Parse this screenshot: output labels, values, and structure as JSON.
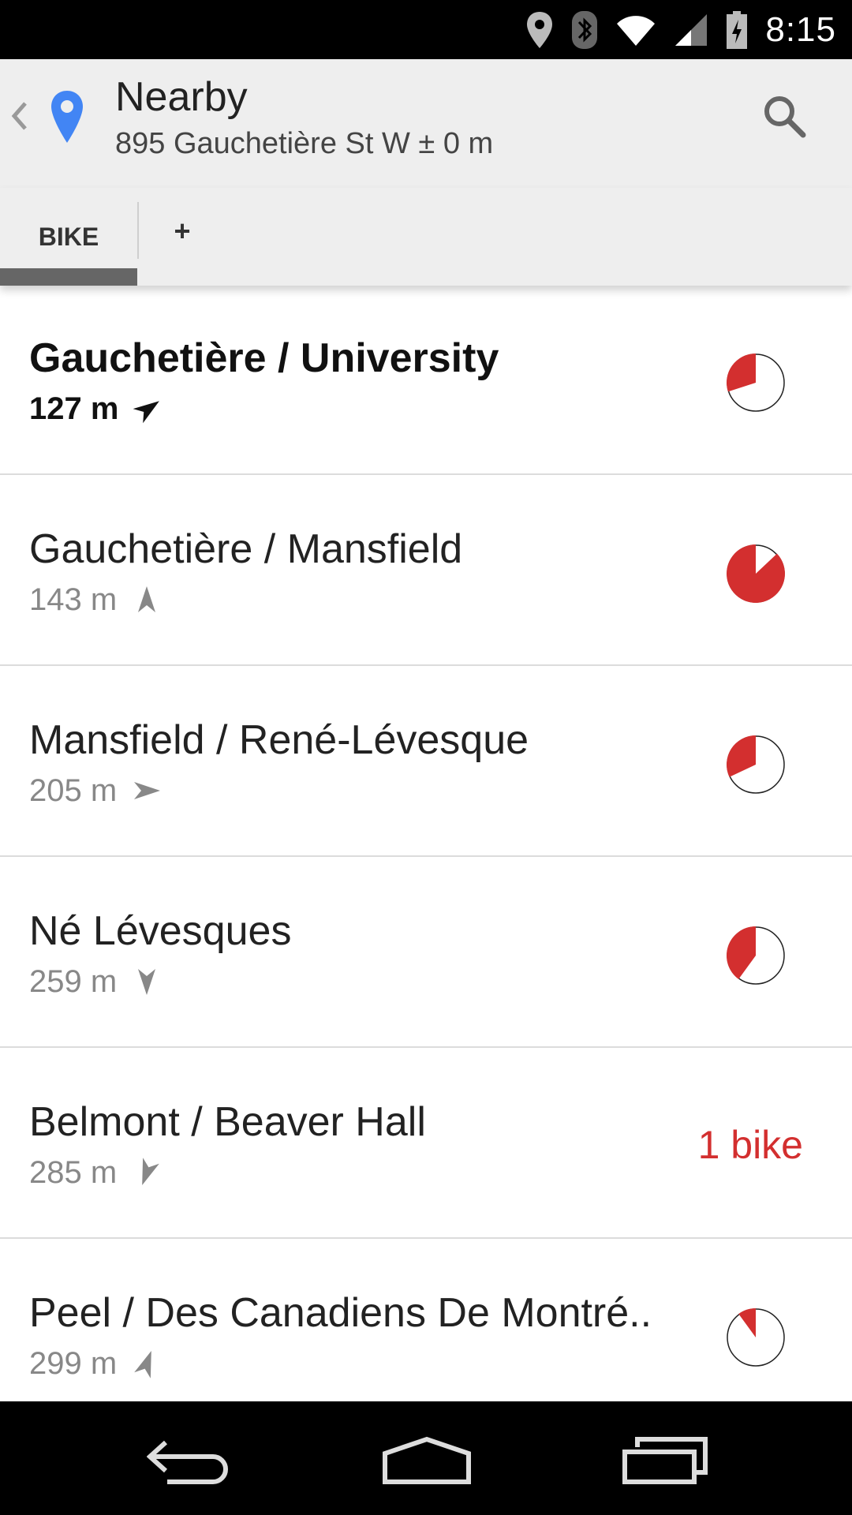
{
  "status_bar": {
    "time": "8:15",
    "icons": [
      "location-icon",
      "bluetooth-icon",
      "wifi-icon",
      "signal-icon",
      "battery-charging-icon"
    ]
  },
  "app_bar": {
    "title": "Nearby",
    "subtitle": "895 Gauchetière St W ± 0 m",
    "icons": [
      "chevron-left-icon",
      "map-pin-icon",
      "search-icon"
    ],
    "pin_color": "#4285f4"
  },
  "tabs": {
    "bike_label": "BIKE",
    "add_label": "+"
  },
  "stations": [
    {
      "name": "Gauchetière / University",
      "distance": "127 m",
      "bearing_deg": 55,
      "availability_fraction": 0.3,
      "bold": true
    },
    {
      "name": "Gauchetière / Mansfield",
      "distance": "143 m",
      "bearing_deg": 0,
      "availability_fraction": 0.87
    },
    {
      "name": "Mansfield / René-Lévesque",
      "distance": "205 m",
      "bearing_deg": 90,
      "availability_fraction": 0.32
    },
    {
      "name": "Né Lévesques",
      "distance": "259 m",
      "bearing_deg": 180,
      "availability_fraction": 0.4
    },
    {
      "name": "Belmont / Beaver Hall",
      "distance": "285 m",
      "bearing_deg": 200,
      "availability_text": "1 bike"
    },
    {
      "name": "Peel / Des Canadiens De Montré..",
      "distance": "299 m",
      "bearing_deg": 20,
      "availability_fraction": 0.1
    }
  ],
  "colors": {
    "availability_red": "#d32f2f",
    "app_bar_bg": "#eeeeee"
  },
  "nav_bar": {
    "icons": [
      "back-icon",
      "home-icon",
      "recents-icon"
    ]
  }
}
